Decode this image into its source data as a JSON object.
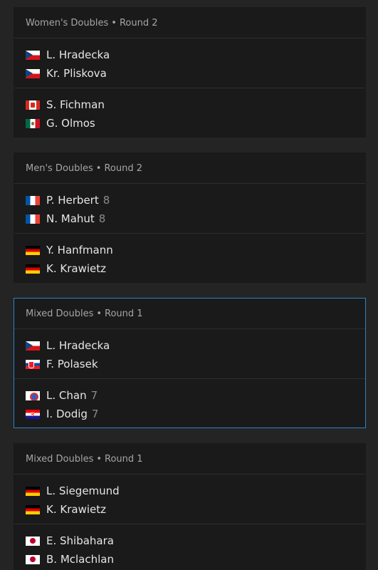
{
  "matches": [
    {
      "event": "Women's Doubles",
      "round": "Round 2",
      "teams": [
        [
          {
            "name": "L. Hradecka",
            "flag": "czech-flag-icon",
            "score": ""
          },
          {
            "name": "Kr. Pliskova",
            "flag": "czech-flag-icon",
            "score": ""
          }
        ],
        [
          {
            "name": "S. Fichman",
            "flag": "canada-flag-icon",
            "score": ""
          },
          {
            "name": "G. Olmos",
            "flag": "mexico-flag-icon",
            "score": ""
          }
        ]
      ]
    },
    {
      "event": "Men's Doubles",
      "round": "Round 2",
      "teams": [
        [
          {
            "name": "P. Herbert",
            "flag": "france-flag-icon",
            "score": "8"
          },
          {
            "name": "N. Mahut",
            "flag": "france-flag-icon",
            "score": "8"
          }
        ],
        [
          {
            "name": "Y. Hanfmann",
            "flag": "germany-flag-icon",
            "score": ""
          },
          {
            "name": "K. Krawietz",
            "flag": "germany-flag-icon",
            "score": ""
          }
        ]
      ]
    },
    {
      "event": "Mixed Doubles",
      "round": "Round 1",
      "teams": [
        [
          {
            "name": "L. Hradecka",
            "flag": "czech-flag-icon",
            "score": ""
          },
          {
            "name": "F. Polasek",
            "flag": "slovakia-flag-icon",
            "score": ""
          }
        ],
        [
          {
            "name": "L. Chan",
            "flag": "chinese-taipei-flag-icon",
            "score": "7"
          },
          {
            "name": "I. Dodig",
            "flag": "croatia-flag-icon",
            "score": "7"
          }
        ]
      ]
    },
    {
      "event": "Mixed Doubles",
      "round": "Round 1",
      "teams": [
        [
          {
            "name": "L. Siegemund",
            "flag": "germany-flag-icon",
            "score": ""
          },
          {
            "name": "K. Krawietz",
            "flag": "germany-flag-icon",
            "score": ""
          }
        ],
        [
          {
            "name": "E. Shibahara",
            "flag": "japan-flag-icon",
            "score": ""
          },
          {
            "name": "B. Mclachlan",
            "flag": "japan-flag-icon",
            "score": ""
          }
        ]
      ]
    }
  ],
  "separator": "•",
  "colors": {
    "background": "#242424",
    "card": "#1a1a1a",
    "divider": "#2e2e2e",
    "selected_border": "#2b84c6",
    "header_text": "#a5a5a5",
    "player_text": "#e6e6e6",
    "score_text": "#8a8a8a"
  }
}
